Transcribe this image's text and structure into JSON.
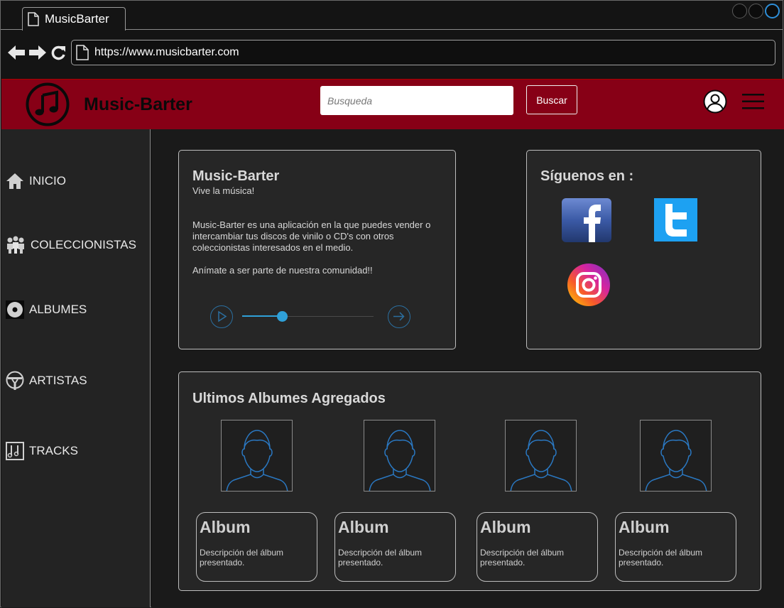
{
  "browser": {
    "tab_title": "MusicBarter",
    "url": "https://www.musicbarter.com"
  },
  "header": {
    "brand": "Music-Barter",
    "search_placeholder": "Busqueda",
    "search_button": "Buscar"
  },
  "sidebar": {
    "items": [
      {
        "label": "INICIO",
        "icon": "home-icon"
      },
      {
        "label": "COLECCIONISTAS",
        "icon": "collectors-icon"
      },
      {
        "label": "ALBUMES",
        "icon": "disc-icon"
      },
      {
        "label": "ARTISTAS",
        "icon": "microphone-icon"
      },
      {
        "label": "TRACKS",
        "icon": "music-note-icon"
      }
    ]
  },
  "about": {
    "title": "Music-Barter",
    "subtitle": "Vive la música!",
    "description": "Music-Barter es una aplicación en la que puedes vender o intercambiar tus discos de vinilo o CD's con otros coleccionistas interesados en el medio.",
    "cta": "Anímate a ser parte de nuestra comunidad!!",
    "player_progress": 0.3
  },
  "social": {
    "title": "Síguenos en :",
    "networks": [
      "facebook-icon",
      "twitter-icon",
      "instagram-icon"
    ]
  },
  "latest": {
    "title": "Ultimos Albumes Agregados",
    "albums": [
      {
        "name": "Album",
        "description": "Descripción del álbum presentado."
      },
      {
        "name": "Album",
        "description": "Descripción del álbum presentado."
      },
      {
        "name": "Album",
        "description": "Descripción del álbum presentado."
      },
      {
        "name": "Album",
        "description": "Descripción del álbum presentado."
      }
    ]
  },
  "colors": {
    "brand_red": "#870016",
    "accent_blue": "#2fa0d8"
  }
}
